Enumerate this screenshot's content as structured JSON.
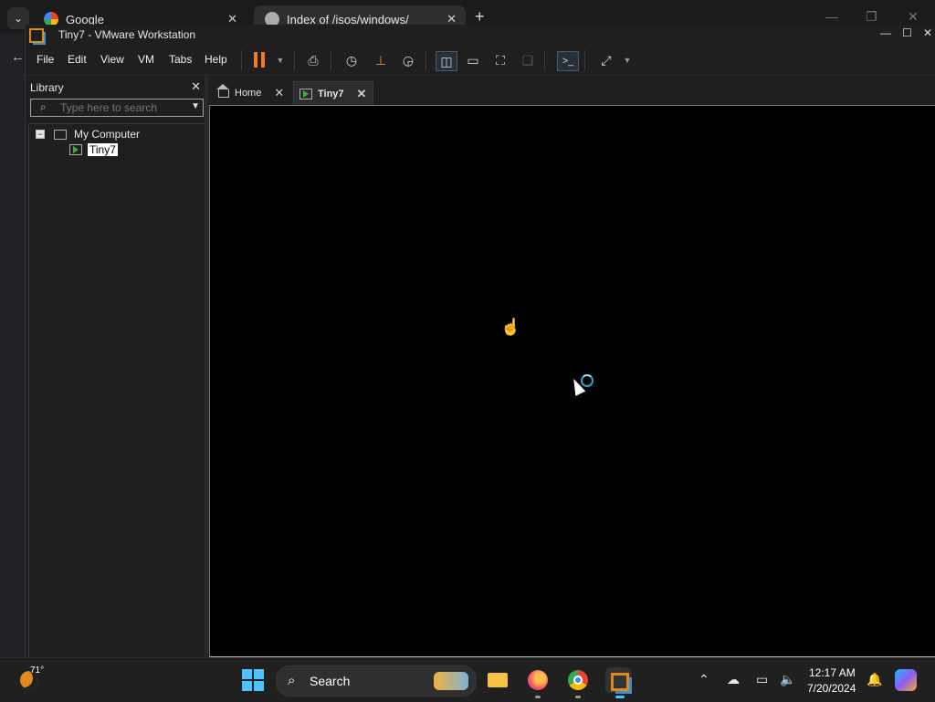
{
  "browser": {
    "tabs": [
      {
        "label": "Google"
      },
      {
        "label": "Index of /isos/windows/"
      }
    ],
    "new_tab": "+",
    "list_glyph": "⌄"
  },
  "vmware": {
    "title": "Tiny7 - VMware Workstation",
    "menu": [
      "File",
      "Edit",
      "View",
      "VM",
      "Tabs",
      "Help"
    ],
    "library": {
      "title": "Library",
      "search_placeholder": "Type here to search",
      "tree": {
        "root": "My Computer",
        "items": [
          "Tiny7"
        ]
      }
    },
    "tabs": [
      {
        "label": "Home"
      },
      {
        "label": "Tiny7"
      }
    ],
    "icons": {
      "pause": "pause-icon",
      "send_keys": "keyboard-icon",
      "snapshot": "snapshot-icon",
      "revert": "revert-snapshot-icon",
      "manage_snapshots": "snapshot-manager-icon",
      "library_view": "show-library-icon",
      "thumbnail": "thumbnail-bar-icon",
      "full_screen": "full-screen-icon",
      "unity": "unity-icon",
      "console_view": "console-view-icon",
      "stretch": "stretch-guest-icon"
    },
    "brand_colors": {
      "orange": "#e08a1e",
      "blue": "#3a8fd1"
    }
  },
  "taskbar": {
    "weather_temp": "71°",
    "search_label": "Search",
    "clock_time": "12:17 AM",
    "clock_date": "7/20/2024"
  }
}
